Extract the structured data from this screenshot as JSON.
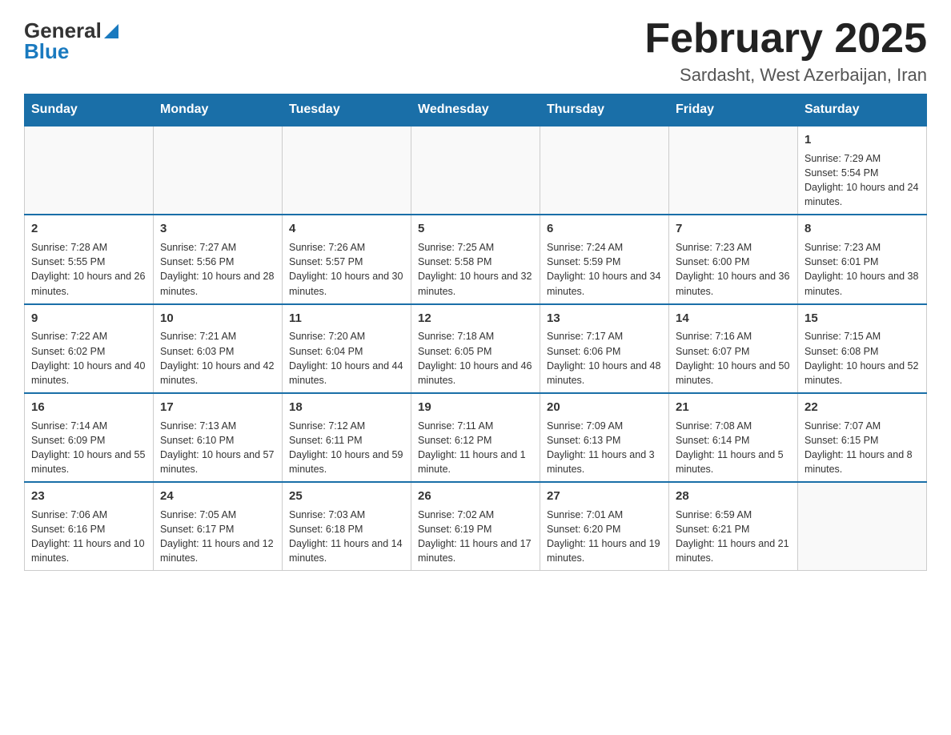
{
  "header": {
    "logo_general": "General",
    "logo_blue": "Blue",
    "month_title": "February 2025",
    "location": "Sardasht, West Azerbaijan, Iran"
  },
  "weekdays": [
    "Sunday",
    "Monday",
    "Tuesday",
    "Wednesday",
    "Thursday",
    "Friday",
    "Saturday"
  ],
  "weeks": [
    [
      {
        "day": "",
        "sunrise": "",
        "sunset": "",
        "daylight": ""
      },
      {
        "day": "",
        "sunrise": "",
        "sunset": "",
        "daylight": ""
      },
      {
        "day": "",
        "sunrise": "",
        "sunset": "",
        "daylight": ""
      },
      {
        "day": "",
        "sunrise": "",
        "sunset": "",
        "daylight": ""
      },
      {
        "day": "",
        "sunrise": "",
        "sunset": "",
        "daylight": ""
      },
      {
        "day": "",
        "sunrise": "",
        "sunset": "",
        "daylight": ""
      },
      {
        "day": "1",
        "sunrise": "Sunrise: 7:29 AM",
        "sunset": "Sunset: 5:54 PM",
        "daylight": "Daylight: 10 hours and 24 minutes."
      }
    ],
    [
      {
        "day": "2",
        "sunrise": "Sunrise: 7:28 AM",
        "sunset": "Sunset: 5:55 PM",
        "daylight": "Daylight: 10 hours and 26 minutes."
      },
      {
        "day": "3",
        "sunrise": "Sunrise: 7:27 AM",
        "sunset": "Sunset: 5:56 PM",
        "daylight": "Daylight: 10 hours and 28 minutes."
      },
      {
        "day": "4",
        "sunrise": "Sunrise: 7:26 AM",
        "sunset": "Sunset: 5:57 PM",
        "daylight": "Daylight: 10 hours and 30 minutes."
      },
      {
        "day": "5",
        "sunrise": "Sunrise: 7:25 AM",
        "sunset": "Sunset: 5:58 PM",
        "daylight": "Daylight: 10 hours and 32 minutes."
      },
      {
        "day": "6",
        "sunrise": "Sunrise: 7:24 AM",
        "sunset": "Sunset: 5:59 PM",
        "daylight": "Daylight: 10 hours and 34 minutes."
      },
      {
        "day": "7",
        "sunrise": "Sunrise: 7:23 AM",
        "sunset": "Sunset: 6:00 PM",
        "daylight": "Daylight: 10 hours and 36 minutes."
      },
      {
        "day": "8",
        "sunrise": "Sunrise: 7:23 AM",
        "sunset": "Sunset: 6:01 PM",
        "daylight": "Daylight: 10 hours and 38 minutes."
      }
    ],
    [
      {
        "day": "9",
        "sunrise": "Sunrise: 7:22 AM",
        "sunset": "Sunset: 6:02 PM",
        "daylight": "Daylight: 10 hours and 40 minutes."
      },
      {
        "day": "10",
        "sunrise": "Sunrise: 7:21 AM",
        "sunset": "Sunset: 6:03 PM",
        "daylight": "Daylight: 10 hours and 42 minutes."
      },
      {
        "day": "11",
        "sunrise": "Sunrise: 7:20 AM",
        "sunset": "Sunset: 6:04 PM",
        "daylight": "Daylight: 10 hours and 44 minutes."
      },
      {
        "day": "12",
        "sunrise": "Sunrise: 7:18 AM",
        "sunset": "Sunset: 6:05 PM",
        "daylight": "Daylight: 10 hours and 46 minutes."
      },
      {
        "day": "13",
        "sunrise": "Sunrise: 7:17 AM",
        "sunset": "Sunset: 6:06 PM",
        "daylight": "Daylight: 10 hours and 48 minutes."
      },
      {
        "day": "14",
        "sunrise": "Sunrise: 7:16 AM",
        "sunset": "Sunset: 6:07 PM",
        "daylight": "Daylight: 10 hours and 50 minutes."
      },
      {
        "day": "15",
        "sunrise": "Sunrise: 7:15 AM",
        "sunset": "Sunset: 6:08 PM",
        "daylight": "Daylight: 10 hours and 52 minutes."
      }
    ],
    [
      {
        "day": "16",
        "sunrise": "Sunrise: 7:14 AM",
        "sunset": "Sunset: 6:09 PM",
        "daylight": "Daylight: 10 hours and 55 minutes."
      },
      {
        "day": "17",
        "sunrise": "Sunrise: 7:13 AM",
        "sunset": "Sunset: 6:10 PM",
        "daylight": "Daylight: 10 hours and 57 minutes."
      },
      {
        "day": "18",
        "sunrise": "Sunrise: 7:12 AM",
        "sunset": "Sunset: 6:11 PM",
        "daylight": "Daylight: 10 hours and 59 minutes."
      },
      {
        "day": "19",
        "sunrise": "Sunrise: 7:11 AM",
        "sunset": "Sunset: 6:12 PM",
        "daylight": "Daylight: 11 hours and 1 minute."
      },
      {
        "day": "20",
        "sunrise": "Sunrise: 7:09 AM",
        "sunset": "Sunset: 6:13 PM",
        "daylight": "Daylight: 11 hours and 3 minutes."
      },
      {
        "day": "21",
        "sunrise": "Sunrise: 7:08 AM",
        "sunset": "Sunset: 6:14 PM",
        "daylight": "Daylight: 11 hours and 5 minutes."
      },
      {
        "day": "22",
        "sunrise": "Sunrise: 7:07 AM",
        "sunset": "Sunset: 6:15 PM",
        "daylight": "Daylight: 11 hours and 8 minutes."
      }
    ],
    [
      {
        "day": "23",
        "sunrise": "Sunrise: 7:06 AM",
        "sunset": "Sunset: 6:16 PM",
        "daylight": "Daylight: 11 hours and 10 minutes."
      },
      {
        "day": "24",
        "sunrise": "Sunrise: 7:05 AM",
        "sunset": "Sunset: 6:17 PM",
        "daylight": "Daylight: 11 hours and 12 minutes."
      },
      {
        "day": "25",
        "sunrise": "Sunrise: 7:03 AM",
        "sunset": "Sunset: 6:18 PM",
        "daylight": "Daylight: 11 hours and 14 minutes."
      },
      {
        "day": "26",
        "sunrise": "Sunrise: 7:02 AM",
        "sunset": "Sunset: 6:19 PM",
        "daylight": "Daylight: 11 hours and 17 minutes."
      },
      {
        "day": "27",
        "sunrise": "Sunrise: 7:01 AM",
        "sunset": "Sunset: 6:20 PM",
        "daylight": "Daylight: 11 hours and 19 minutes."
      },
      {
        "day": "28",
        "sunrise": "Sunrise: 6:59 AM",
        "sunset": "Sunset: 6:21 PM",
        "daylight": "Daylight: 11 hours and 21 minutes."
      },
      {
        "day": "",
        "sunrise": "",
        "sunset": "",
        "daylight": ""
      }
    ]
  ]
}
